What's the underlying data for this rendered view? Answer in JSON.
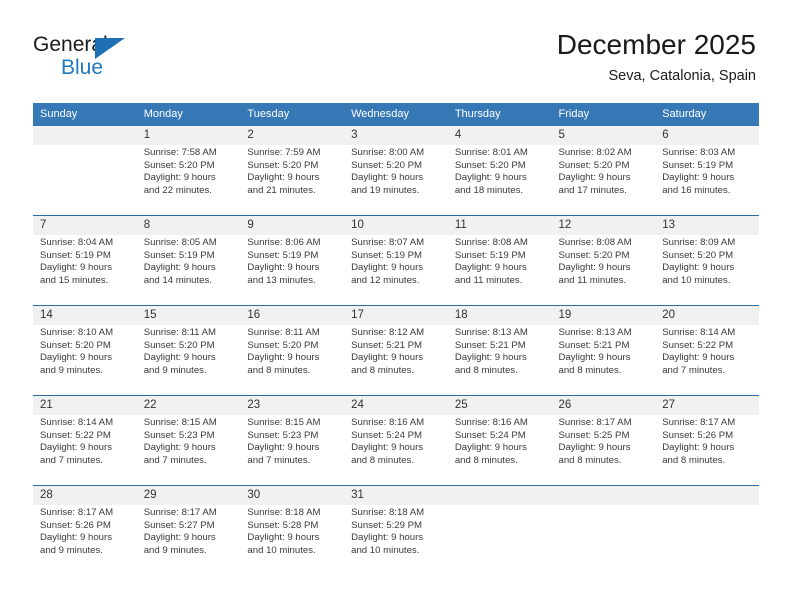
{
  "brand": {
    "name_top": "General",
    "name_bottom": "Blue",
    "triangle_icon": "blue-triangle-icon",
    "accent_color": "#1f7ac0"
  },
  "header": {
    "title": "December 2025",
    "subtitle": "Seva, Catalonia, Spain"
  },
  "colors": {
    "header_band": "#3578b5",
    "day_number_band": "#f1f1f1",
    "week_divider": "#2e6da4",
    "text": "#3a3a3a"
  },
  "weekday_headers": [
    "Sunday",
    "Monday",
    "Tuesday",
    "Wednesday",
    "Thursday",
    "Friday",
    "Saturday"
  ],
  "labels": {
    "sunrise_prefix": "Sunrise:",
    "sunset_prefix": "Sunset:",
    "daylight_prefix": "Daylight:"
  },
  "weeks": [
    {
      "numbers": [
        "",
        "1",
        "2",
        "3",
        "4",
        "5",
        "6"
      ],
      "cells": [
        {
          "empty": true
        },
        {
          "sunrise": "Sunrise: 7:58 AM",
          "sunset": "Sunset: 5:20 PM",
          "daylight_1": "Daylight: 9 hours",
          "daylight_2": "and 22 minutes."
        },
        {
          "sunrise": "Sunrise: 7:59 AM",
          "sunset": "Sunset: 5:20 PM",
          "daylight_1": "Daylight: 9 hours",
          "daylight_2": "and 21 minutes."
        },
        {
          "sunrise": "Sunrise: 8:00 AM",
          "sunset": "Sunset: 5:20 PM",
          "daylight_1": "Daylight: 9 hours",
          "daylight_2": "and 19 minutes."
        },
        {
          "sunrise": "Sunrise: 8:01 AM",
          "sunset": "Sunset: 5:20 PM",
          "daylight_1": "Daylight: 9 hours",
          "daylight_2": "and 18 minutes."
        },
        {
          "sunrise": "Sunrise: 8:02 AM",
          "sunset": "Sunset: 5:20 PM",
          "daylight_1": "Daylight: 9 hours",
          "daylight_2": "and 17 minutes."
        },
        {
          "sunrise": "Sunrise: 8:03 AM",
          "sunset": "Sunset: 5:19 PM",
          "daylight_1": "Daylight: 9 hours",
          "daylight_2": "and 16 minutes."
        }
      ]
    },
    {
      "numbers": [
        "7",
        "8",
        "9",
        "10",
        "11",
        "12",
        "13"
      ],
      "cells": [
        {
          "sunrise": "Sunrise: 8:04 AM",
          "sunset": "Sunset: 5:19 PM",
          "daylight_1": "Daylight: 9 hours",
          "daylight_2": "and 15 minutes."
        },
        {
          "sunrise": "Sunrise: 8:05 AM",
          "sunset": "Sunset: 5:19 PM",
          "daylight_1": "Daylight: 9 hours",
          "daylight_2": "and 14 minutes."
        },
        {
          "sunrise": "Sunrise: 8:06 AM",
          "sunset": "Sunset: 5:19 PM",
          "daylight_1": "Daylight: 9 hours",
          "daylight_2": "and 13 minutes."
        },
        {
          "sunrise": "Sunrise: 8:07 AM",
          "sunset": "Sunset: 5:19 PM",
          "daylight_1": "Daylight: 9 hours",
          "daylight_2": "and 12 minutes."
        },
        {
          "sunrise": "Sunrise: 8:08 AM",
          "sunset": "Sunset: 5:19 PM",
          "daylight_1": "Daylight: 9 hours",
          "daylight_2": "and 11 minutes."
        },
        {
          "sunrise": "Sunrise: 8:08 AM",
          "sunset": "Sunset: 5:20 PM",
          "daylight_1": "Daylight: 9 hours",
          "daylight_2": "and 11 minutes."
        },
        {
          "sunrise": "Sunrise: 8:09 AM",
          "sunset": "Sunset: 5:20 PM",
          "daylight_1": "Daylight: 9 hours",
          "daylight_2": "and 10 minutes."
        }
      ]
    },
    {
      "numbers": [
        "14",
        "15",
        "16",
        "17",
        "18",
        "19",
        "20"
      ],
      "cells": [
        {
          "sunrise": "Sunrise: 8:10 AM",
          "sunset": "Sunset: 5:20 PM",
          "daylight_1": "Daylight: 9 hours",
          "daylight_2": "and 9 minutes."
        },
        {
          "sunrise": "Sunrise: 8:11 AM",
          "sunset": "Sunset: 5:20 PM",
          "daylight_1": "Daylight: 9 hours",
          "daylight_2": "and 9 minutes."
        },
        {
          "sunrise": "Sunrise: 8:11 AM",
          "sunset": "Sunset: 5:20 PM",
          "daylight_1": "Daylight: 9 hours",
          "daylight_2": "and 8 minutes."
        },
        {
          "sunrise": "Sunrise: 8:12 AM",
          "sunset": "Sunset: 5:21 PM",
          "daylight_1": "Daylight: 9 hours",
          "daylight_2": "and 8 minutes."
        },
        {
          "sunrise": "Sunrise: 8:13 AM",
          "sunset": "Sunset: 5:21 PM",
          "daylight_1": "Daylight: 9 hours",
          "daylight_2": "and 8 minutes."
        },
        {
          "sunrise": "Sunrise: 8:13 AM",
          "sunset": "Sunset: 5:21 PM",
          "daylight_1": "Daylight: 9 hours",
          "daylight_2": "and 8 minutes."
        },
        {
          "sunrise": "Sunrise: 8:14 AM",
          "sunset": "Sunset: 5:22 PM",
          "daylight_1": "Daylight: 9 hours",
          "daylight_2": "and 7 minutes."
        }
      ]
    },
    {
      "numbers": [
        "21",
        "22",
        "23",
        "24",
        "25",
        "26",
        "27"
      ],
      "cells": [
        {
          "sunrise": "Sunrise: 8:14 AM",
          "sunset": "Sunset: 5:22 PM",
          "daylight_1": "Daylight: 9 hours",
          "daylight_2": "and 7 minutes."
        },
        {
          "sunrise": "Sunrise: 8:15 AM",
          "sunset": "Sunset: 5:23 PM",
          "daylight_1": "Daylight: 9 hours",
          "daylight_2": "and 7 minutes."
        },
        {
          "sunrise": "Sunrise: 8:15 AM",
          "sunset": "Sunset: 5:23 PM",
          "daylight_1": "Daylight: 9 hours",
          "daylight_2": "and 7 minutes."
        },
        {
          "sunrise": "Sunrise: 8:16 AM",
          "sunset": "Sunset: 5:24 PM",
          "daylight_1": "Daylight: 9 hours",
          "daylight_2": "and 8 minutes."
        },
        {
          "sunrise": "Sunrise: 8:16 AM",
          "sunset": "Sunset: 5:24 PM",
          "daylight_1": "Daylight: 9 hours",
          "daylight_2": "and 8 minutes."
        },
        {
          "sunrise": "Sunrise: 8:17 AM",
          "sunset": "Sunset: 5:25 PM",
          "daylight_1": "Daylight: 9 hours",
          "daylight_2": "and 8 minutes."
        },
        {
          "sunrise": "Sunrise: 8:17 AM",
          "sunset": "Sunset: 5:26 PM",
          "daylight_1": "Daylight: 9 hours",
          "daylight_2": "and 8 minutes."
        }
      ]
    },
    {
      "numbers": [
        "28",
        "29",
        "30",
        "31",
        "",
        "",
        ""
      ],
      "cells": [
        {
          "sunrise": "Sunrise: 8:17 AM",
          "sunset": "Sunset: 5:26 PM",
          "daylight_1": "Daylight: 9 hours",
          "daylight_2": "and 9 minutes."
        },
        {
          "sunrise": "Sunrise: 8:17 AM",
          "sunset": "Sunset: 5:27 PM",
          "daylight_1": "Daylight: 9 hours",
          "daylight_2": "and 9 minutes."
        },
        {
          "sunrise": "Sunrise: 8:18 AM",
          "sunset": "Sunset: 5:28 PM",
          "daylight_1": "Daylight: 9 hours",
          "daylight_2": "and 10 minutes."
        },
        {
          "sunrise": "Sunrise: 8:18 AM",
          "sunset": "Sunset: 5:29 PM",
          "daylight_1": "Daylight: 9 hours",
          "daylight_2": "and 10 minutes."
        },
        {
          "empty": true
        },
        {
          "empty": true
        },
        {
          "empty": true
        }
      ]
    }
  ]
}
